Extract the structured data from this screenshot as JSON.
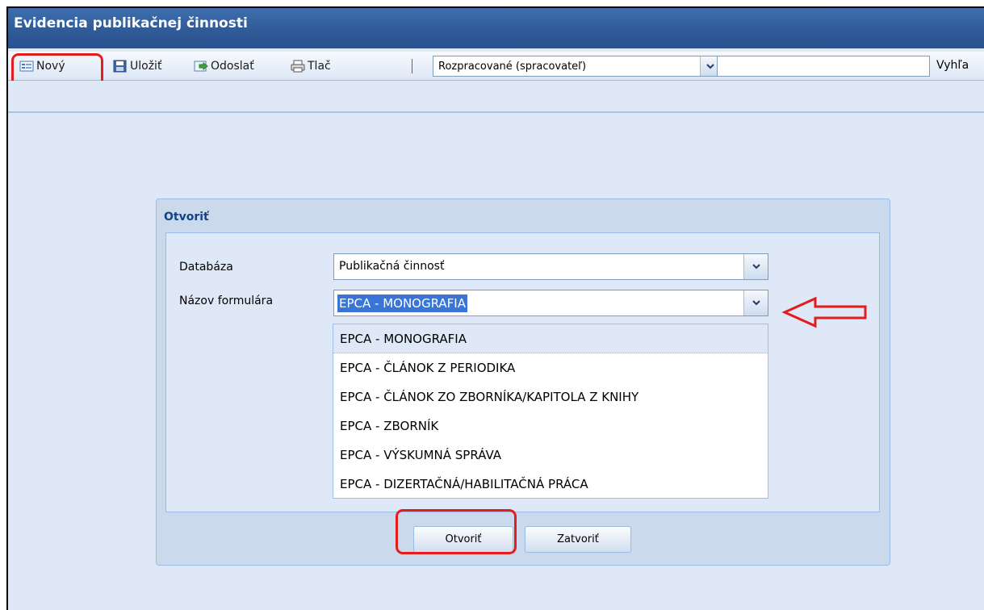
{
  "window": {
    "title": "Evidencia publikačnej činnosti"
  },
  "toolbar": {
    "new_label": "Nový",
    "save_label": "Uložiť",
    "send_label": "Odoslať",
    "print_label": "Tlač",
    "separator": "|",
    "status_filter": "Rozpracované (spracovateľ)",
    "search_value": "",
    "search_label": "Vyhľa"
  },
  "dialog": {
    "title": "Otvoriť",
    "database_label": "Databáza",
    "database_value": "Publikačná činnosť",
    "form_name_label": "Názov formulára",
    "form_name_value": "EPCA - MONOGRAFIA",
    "options": [
      "EPCA - MONOGRAFIA",
      "EPCA - ČLÁNOK Z PERIODIKA",
      "EPCA - ČLÁNOK ZO ZBORNÍKA/KAPITOLA Z KNIHY",
      "EPCA - ZBORNÍK",
      "EPCA - VÝSKUMNÁ SPRÁVA",
      "EPCA - DIZERTAČNÁ/HABILITAČNÁ PRÁCA"
    ],
    "open_button": "Otvoriť",
    "close_button": "Zatvoriť"
  },
  "colors": {
    "title_bar": "#2f5b97",
    "highlight": "#e31c1c",
    "selection": "#3875d7",
    "panel": "#dfe8f6"
  }
}
